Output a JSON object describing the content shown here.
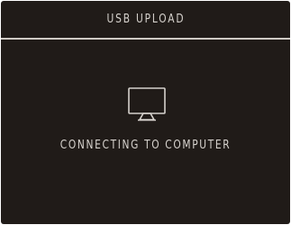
{
  "header": {
    "title": "USB UPLOAD"
  },
  "main": {
    "icon": "monitor-icon",
    "status_text": "CONNECTING TO COMPUTER"
  },
  "colors": {
    "background": "#201b18",
    "text": "#d6d2cd",
    "divider": "#cfcac4"
  }
}
